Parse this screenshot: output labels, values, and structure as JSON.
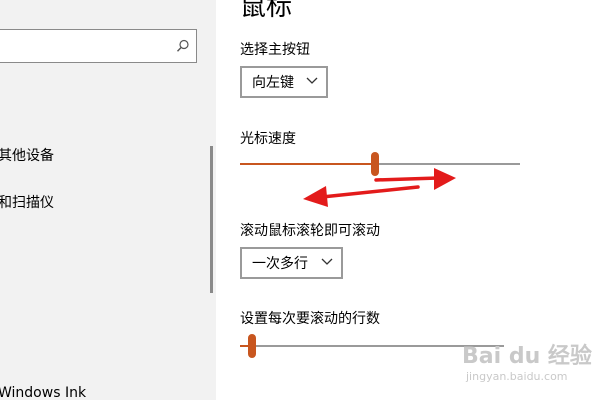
{
  "page": {
    "title": "鼠标"
  },
  "nav": {
    "search_placeholder": "",
    "items": [
      {
        "label": "其他设备"
      },
      {
        "label": "和扫描仪"
      },
      {
        "label": "Windows Ink"
      }
    ]
  },
  "settings": {
    "primary_button": {
      "label": "选择主按钮",
      "value": "向左键"
    },
    "cursor_speed": {
      "label": "光标速度",
      "value": 0.48
    },
    "wheel_scroll": {
      "label": "滚动鼠标滚轮即可滚动",
      "value": "一次多行"
    },
    "lines_per_scroll": {
      "label": "设置每次要滚动的行数",
      "value": 0.03
    }
  },
  "watermark": {
    "brand": "Bai du 经验",
    "url": "jingyan.baidu.com"
  },
  "colors": {
    "accent": "#c8561f",
    "annotation_arrow": "#e31b1b",
    "nav_background": "#f2f2f2"
  },
  "icons": {
    "search": "search-icon",
    "dropdown": "chevron-down-icon"
  }
}
